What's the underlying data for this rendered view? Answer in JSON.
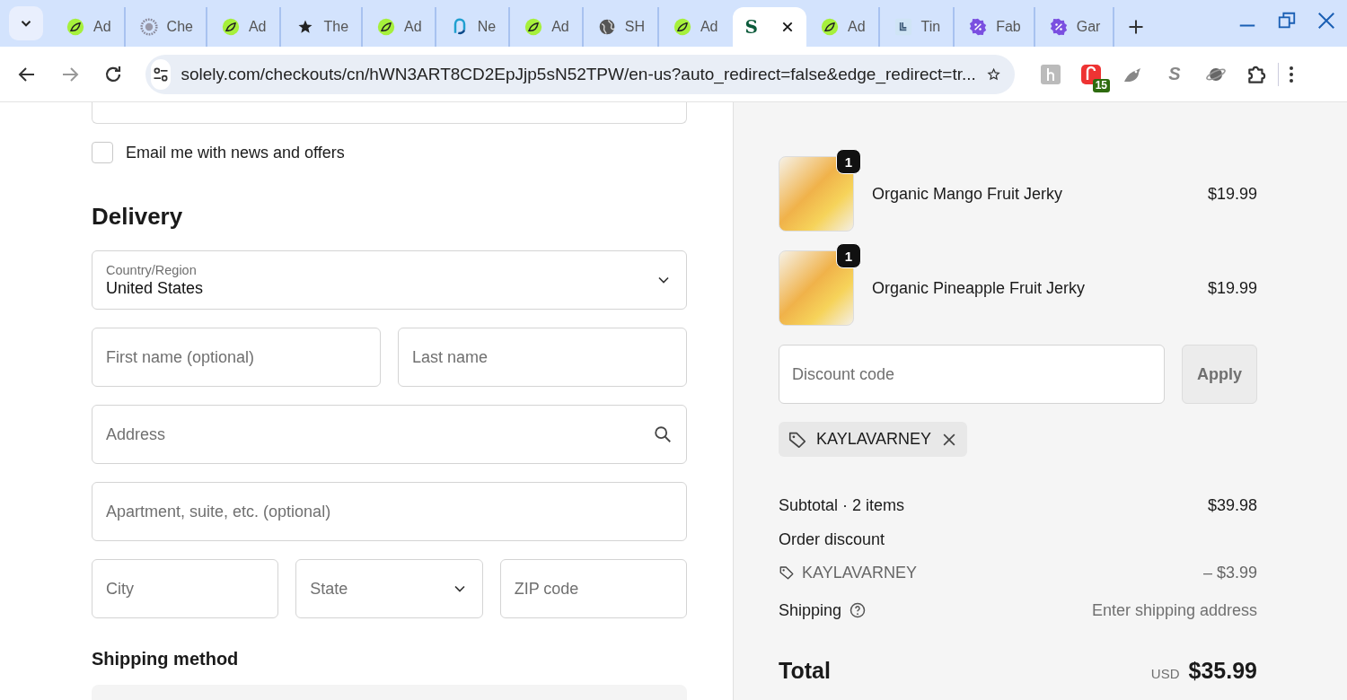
{
  "browser": {
    "tabs": [
      {
        "title": "Ad",
        "kind": "leaf",
        "selected": false
      },
      {
        "title": "Che",
        "kind": "flower",
        "selected": false
      },
      {
        "title": "Ad",
        "kind": "leaf",
        "selected": false
      },
      {
        "title": "The",
        "kind": "star",
        "selected": false
      },
      {
        "title": "Ad",
        "kind": "leaf",
        "selected": false
      },
      {
        "title": "Ne",
        "kind": "n",
        "selected": false
      },
      {
        "title": "Ad",
        "kind": "leaf",
        "selected": false
      },
      {
        "title": "SH",
        "kind": "globe",
        "selected": false
      },
      {
        "title": "Ad",
        "kind": "leaf",
        "selected": false
      },
      {
        "kind": "letter",
        "favicon_text": "S",
        "selected": true
      },
      {
        "title": "Ad",
        "kind": "leaf",
        "selected": false
      },
      {
        "title": "Tin",
        "kind": "g",
        "selected": false
      },
      {
        "title": "Fab",
        "kind": "percent",
        "selected": false
      },
      {
        "title": "Gar",
        "kind": "percent",
        "selected": false
      }
    ],
    "address": "solely.com/checkouts/cn/hWN3ART8CD2EpJjp5sN52TPW/en-us?auto_redirect=false&edge_redirect=tr...",
    "extensions": [
      {
        "kind": "h"
      },
      {
        "kind": "badge",
        "badge": "15"
      },
      {
        "kind": "bird"
      },
      {
        "kind": "letter",
        "text": "S"
      },
      {
        "kind": "planet"
      },
      {
        "kind": "puzzle"
      }
    ]
  },
  "newsletter": {
    "label": "Email me with news and offers",
    "checked": false
  },
  "delivery": {
    "heading": "Delivery",
    "rows": [
      [
        {
          "kind": "select",
          "label": "Country/Region",
          "value": "United States"
        }
      ],
      [
        {
          "kind": "text",
          "placeholder": "First name (optional)"
        },
        {
          "kind": "text",
          "placeholder": "Last name"
        }
      ],
      [
        {
          "kind": "search",
          "placeholder": "Address"
        }
      ],
      [
        {
          "kind": "text",
          "placeholder": "Apartment, suite, etc. (optional)"
        }
      ],
      [
        {
          "kind": "text",
          "placeholder": "City"
        },
        {
          "kind": "select",
          "placeholder": "State"
        },
        {
          "kind": "text",
          "placeholder": "ZIP code"
        }
      ]
    ]
  },
  "shipping_method": {
    "heading": "Shipping method"
  },
  "summary": {
    "items": [
      {
        "name": "Organic Mango Fruit Jerky",
        "price": "$19.99",
        "quantity": "1"
      },
      {
        "name": "Organic Pineapple Fruit Jerky",
        "price": "$19.99",
        "quantity": "1"
      }
    ],
    "discount_field": {
      "placeholder": "Discount code"
    },
    "apply_button": "Apply",
    "applied_codes": [
      "KAYLAVARNEY"
    ],
    "lines": [
      {
        "kind": "plain",
        "label": "Subtotal · 2 items",
        "value": "$39.98"
      },
      {
        "kind": "heading",
        "label": "Order discount"
      },
      {
        "kind": "code",
        "label": "KAYLAVARNEY",
        "value": "– $3.99"
      },
      {
        "kind": "help",
        "label": "Shipping",
        "value": "Enter shipping address"
      }
    ],
    "total": {
      "label": "Total",
      "currency": "USD",
      "amount": "$35.99"
    }
  }
}
